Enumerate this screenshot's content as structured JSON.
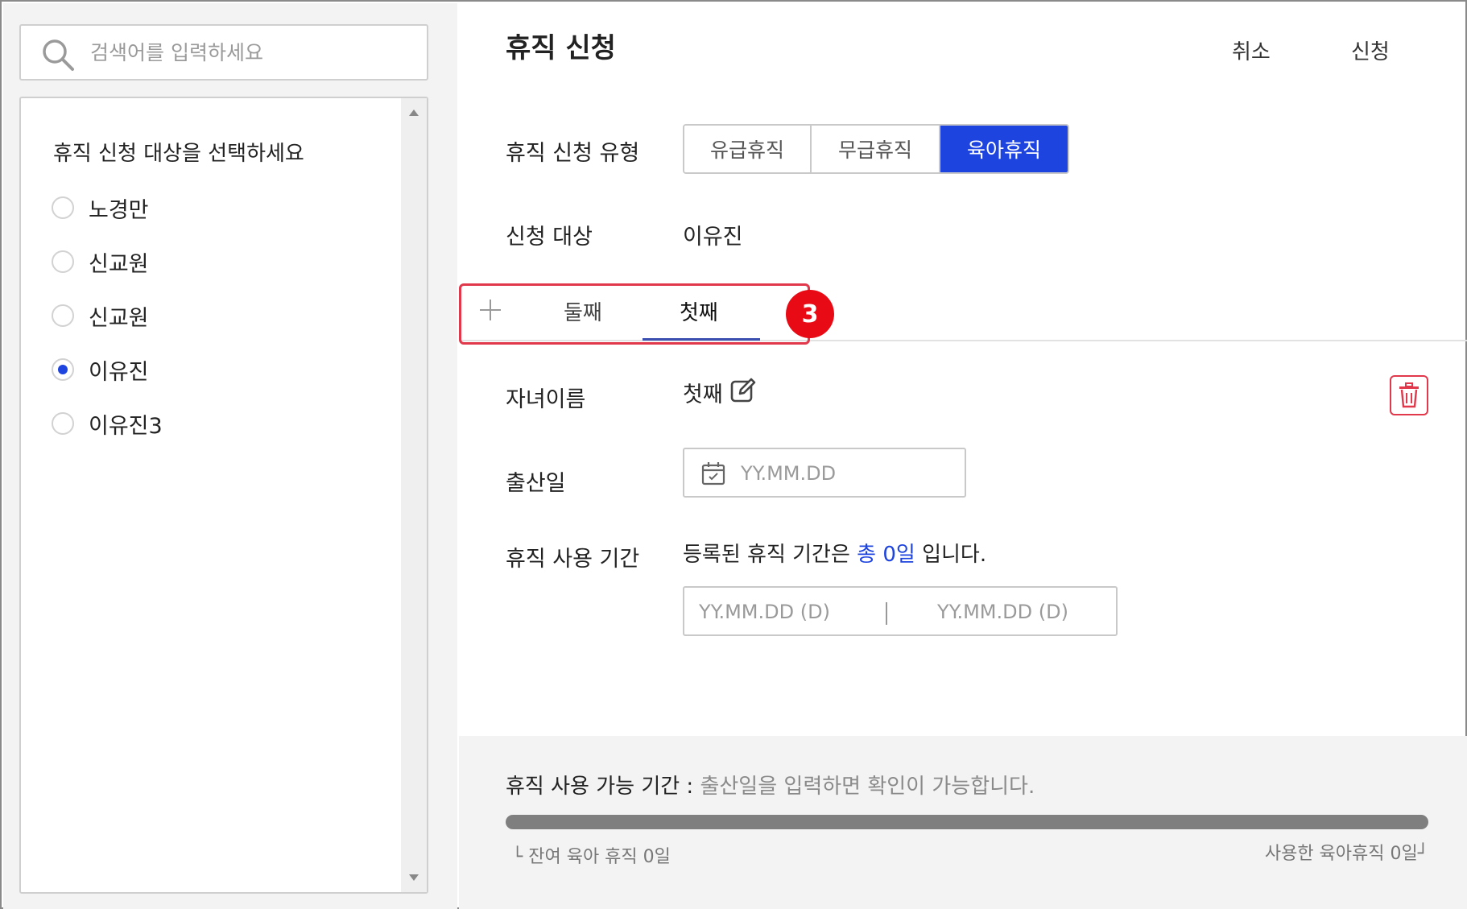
{
  "search": {
    "placeholder": "검색어를 입력하세요"
  },
  "target_list": {
    "title": "휴직 신청 대상을 선택하세요",
    "items": [
      {
        "label": "노경만",
        "checked": false
      },
      {
        "label": "신교원",
        "checked": false
      },
      {
        "label": "신교원",
        "checked": false
      },
      {
        "label": "이유진",
        "checked": true
      },
      {
        "label": "이유진3",
        "checked": false
      }
    ]
  },
  "header": {
    "title": "휴직 신청",
    "cancel_label": "취소",
    "submit_label": "신청"
  },
  "form": {
    "leave_type_label": "휴직 신청 유형",
    "leave_types": [
      "유급휴직",
      "무급휴직",
      "육아휴직"
    ],
    "leave_type_selected": "육아휴직",
    "target_label": "신청 대상",
    "target_value": "이유진",
    "child_name_label": "자녀이름",
    "child_name_value": "첫째",
    "birth_date_label": "출산일",
    "birth_date_placeholder": "YY.MM.DD",
    "period_label": "휴직 사용 기간",
    "period_text_prefix": "등록된 휴직 기간은 ",
    "period_total": "총 0일",
    "period_text_suffix": " 입니다.",
    "period_start_placeholder": "YY.MM.DD (D)",
    "period_end_placeholder": "YY.MM.DD (D)"
  },
  "child_tabs": {
    "tabs": [
      "둘째",
      "첫째"
    ],
    "active": "첫째",
    "badge": "3"
  },
  "availability": {
    "label": "휴직 사용 가능 기간 : ",
    "hint": "출산일을 입력하면 확인이 가능합니다.",
    "progress": 0,
    "remaining_text": "└ 잔여 육아 휴직 0일",
    "used_text": "사용한 육아휴직 0일┘"
  },
  "colors": {
    "accent": "#1e44e0",
    "highlight": "#e2384b",
    "badge": "#e80a14"
  },
  "icons": [
    "search-icon",
    "plus-icon",
    "edit-icon",
    "trash-icon",
    "calendar-icon"
  ]
}
